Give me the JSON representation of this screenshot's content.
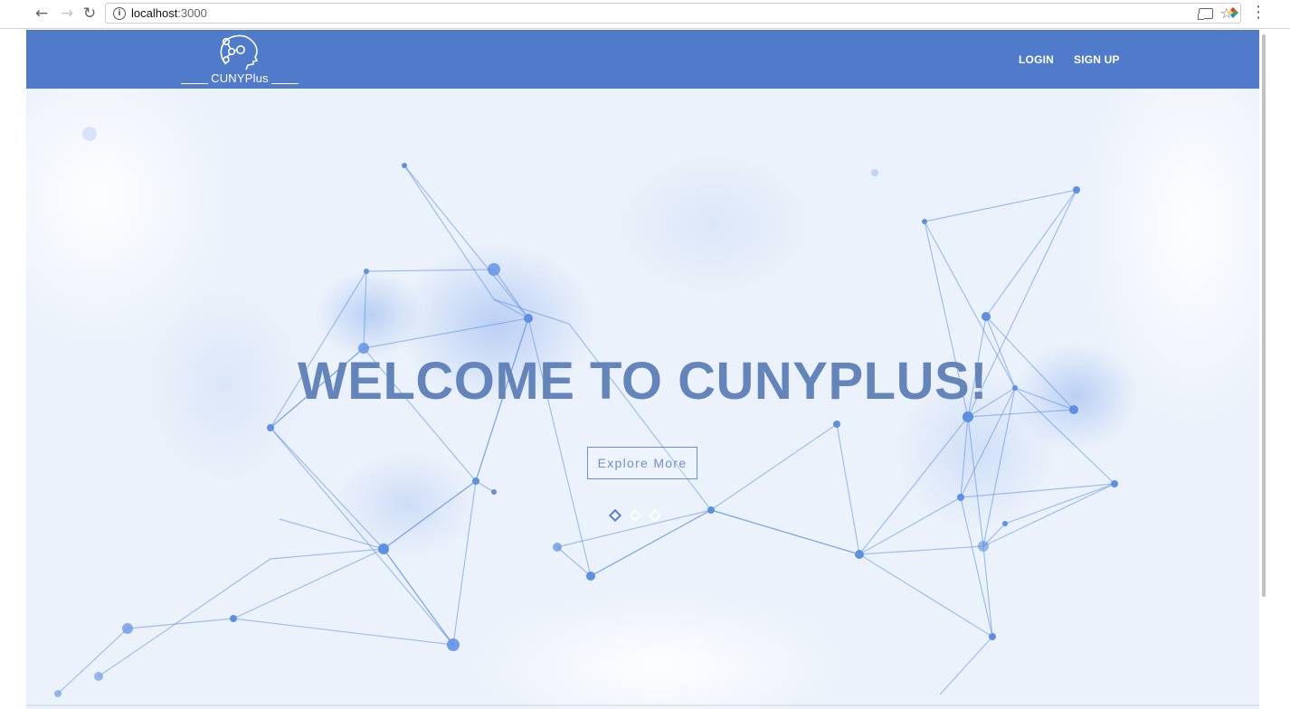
{
  "browser": {
    "back_icon": "arrow-left-icon",
    "forward_icon": "arrow-right-icon",
    "reload_icon": "reload-icon",
    "url_host": "localhost",
    "url_port": ":3000",
    "info_icon": "info-icon",
    "bookmark_icon": "star-icon",
    "cast_icon": "cast-icon",
    "extension_icon": "color-picker-icon",
    "menu_icon": "more-vert-icon"
  },
  "header": {
    "brand": "CUNYPlus",
    "logo_icon": "head-network-icon",
    "background": "#4f7bca",
    "nav": [
      {
        "label": "LOGIN"
      },
      {
        "label": "SIGN UP"
      }
    ]
  },
  "hero": {
    "title": "WELCOME TO CUNYPLUS!",
    "title_color": "#6485bb",
    "cta_label": "Explore More",
    "accent": "#6d8fd0",
    "slides": {
      "count": 3,
      "active": 1
    }
  }
}
